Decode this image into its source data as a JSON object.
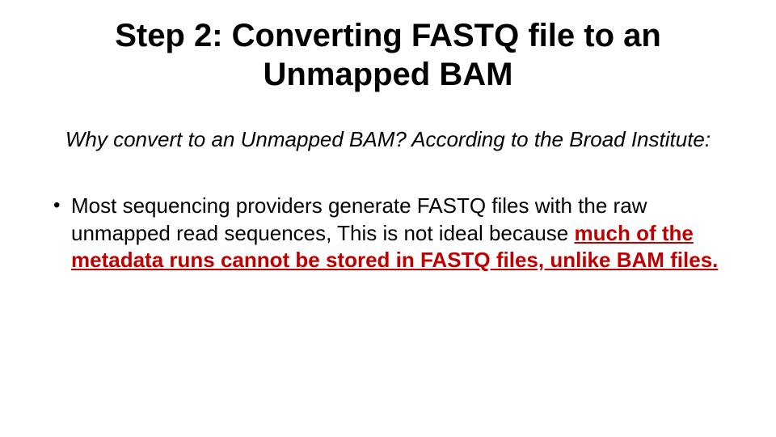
{
  "title": "Step 2:  Converting FASTQ file to an Unmapped BAM",
  "subtitle": "Why convert to an Unmapped BAM?  According to the Broad Institute:",
  "bullet_prefix": "Most sequencing providers generate FASTQ files with the raw unmapped read sequences, This is not ideal because ",
  "bullet_emph": "much of the metadata runs cannot be stored in FASTQ files, unlike BAM files."
}
